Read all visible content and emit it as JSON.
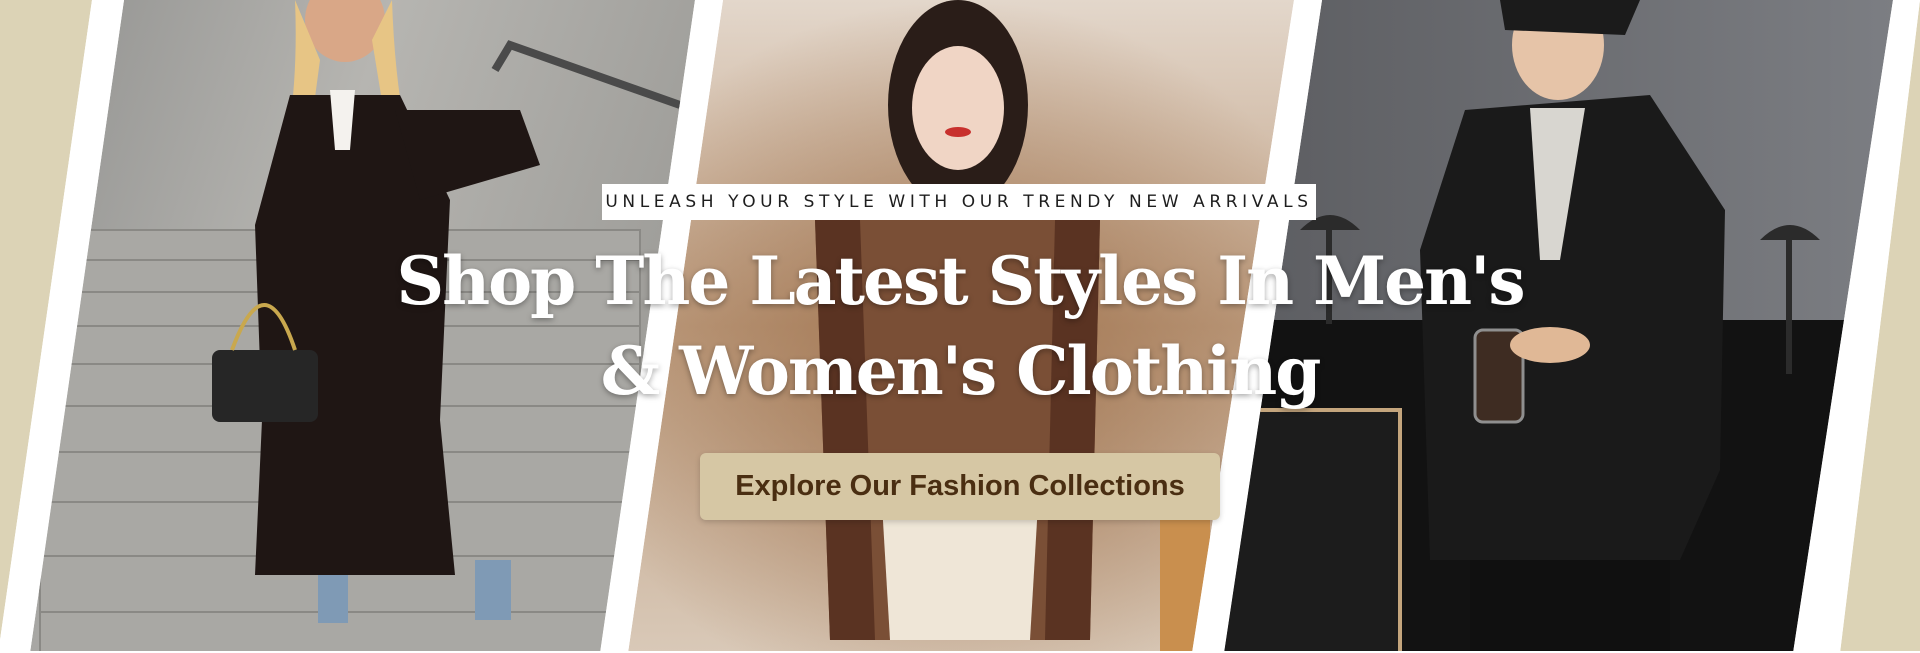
{
  "hero": {
    "tagline": "UNLEASH YOUR STYLE WITH OUR TRENDY NEW ARRIVALS",
    "headline_line1": "Shop The Latest Styles In Men's",
    "headline_line2": "& Women's Clothing",
    "cta_label": "Explore Our Fashion Collections"
  },
  "photos": [
    {
      "name": "woman-in-black-coat-on-stairs-photo"
    },
    {
      "name": "woman-in-hoodie-sweater-photo"
    },
    {
      "name": "man-in-leather-jacket-photo"
    }
  ],
  "colors": {
    "frame_beige": "#dcd3b6",
    "cta_background": "#d6c7a4",
    "cta_text": "#4a2e12",
    "tagline_background": "#ffffff",
    "headline_text": "#ffffff"
  }
}
